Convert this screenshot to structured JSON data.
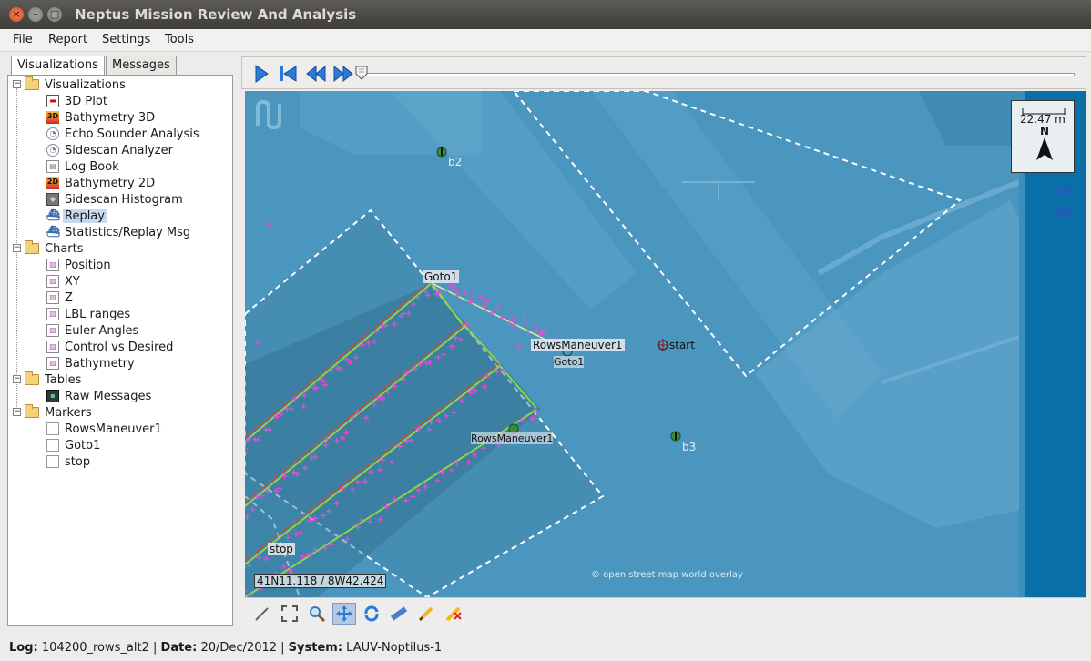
{
  "window": {
    "title": "Neptus Mission Review And Analysis"
  },
  "menu": [
    "File",
    "Report",
    "Settings",
    "Tools"
  ],
  "tabs": [
    "Visualizations",
    "Messages"
  ],
  "tree": {
    "visualizations": {
      "label": "Visualizations",
      "items": [
        "3D Plot",
        "Bathymetry 3D",
        "Echo Sounder Analysis",
        "Sidescan Analyzer",
        "Log Book",
        "Bathymetry 2D",
        "Sidescan Histogram",
        "Replay",
        "Statistics/Replay Msg"
      ]
    },
    "charts": {
      "label": "Charts",
      "items": [
        "Position",
        "XY",
        "Z",
        "LBL ranges",
        "Euler Angles",
        "Control vs Desired",
        "Bathymetry"
      ]
    },
    "tables": {
      "label": "Tables",
      "items": [
        "Raw Messages"
      ]
    },
    "markers": {
      "label": "Markers",
      "items": [
        "RowsManeuver1",
        "Goto1",
        "stop"
      ]
    }
  },
  "map": {
    "scale": "22.47 m",
    "north": "N",
    "labels": {
      "b2": "b2",
      "b3": "b3",
      "goto1": "Goto1",
      "rows_maneuver": "RowsManeuver1",
      "goto1_small": "Goto1",
      "rows_maneuver_small": "RowsManeuver1",
      "start": "start",
      "stop": "stop"
    },
    "coordinates": "41N11.118 / 8W42.424",
    "overlay_credit": "© open street map world overlay"
  },
  "status": {
    "log_label": "Log:",
    "log": "104200_rows_alt2",
    "date_label": "Date:",
    "date": "20/Dec/2012",
    "system_label": "System:",
    "system": "LAUV-Noptilus-1"
  },
  "colors": {
    "map_water": "#4a96bf",
    "track": "#e24fd6",
    "plan_line": "#7fd14b",
    "selected": "#c8d8ee"
  }
}
